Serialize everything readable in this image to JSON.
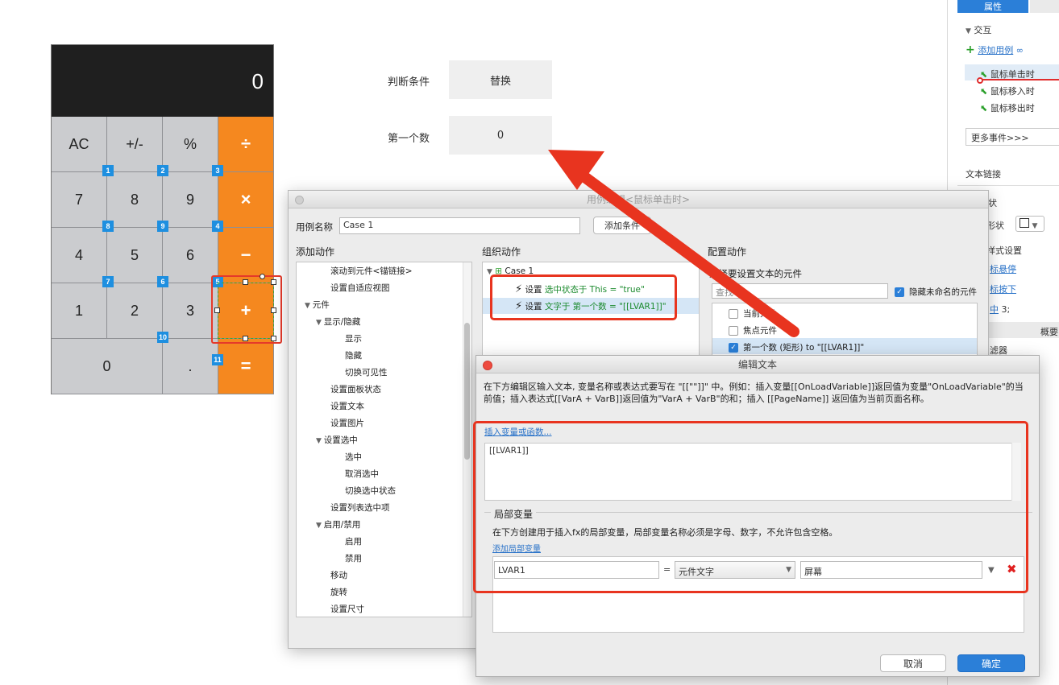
{
  "calculator": {
    "display": "0",
    "keys": [
      {
        "label": "AC",
        "op": false
      },
      {
        "label": "+/-",
        "op": false
      },
      {
        "label": "%",
        "op": false
      },
      {
        "label": "÷",
        "op": true
      },
      {
        "label": "7",
        "op": false
      },
      {
        "label": "8",
        "op": false
      },
      {
        "label": "9",
        "op": false
      },
      {
        "label": "×",
        "op": true
      },
      {
        "label": "4",
        "op": false
      },
      {
        "label": "5",
        "op": false
      },
      {
        "label": "6",
        "op": false
      },
      {
        "label": "−",
        "op": true
      },
      {
        "label": "1",
        "op": false
      },
      {
        "label": "2",
        "op": false
      },
      {
        "label": "3",
        "op": false
      },
      {
        "label": "+",
        "op": true
      },
      {
        "label": "0",
        "op": false
      },
      {
        "label": ".",
        "op": false
      },
      {
        "label": "=",
        "op": true
      }
    ],
    "tags": [
      "1",
      "2",
      "3",
      "8",
      "9",
      "4",
      "7",
      "6",
      "5",
      "10",
      "11"
    ],
    "accent_color": "#f5881f"
  },
  "canvas": {
    "condition_label": "判断条件",
    "condition_value": "替换",
    "first_number_label": "第一个数",
    "first_number_value": "0"
  },
  "right_panel": {
    "tab_properties": "属性",
    "section_interaction": "交互",
    "add_case": "添加用例",
    "events": [
      "鼠标单击时",
      "鼠标移入时",
      "鼠标移出时"
    ],
    "more_events": "更多事件>>>",
    "text_link": "文本链接",
    "shape_label": "形状",
    "style_settings": "样式设置",
    "hover_link": "标悬停",
    "pressed_link": "标按下",
    "selected_text": "中",
    "selected_value": "3;",
    "overview_tab": "概要",
    "filter_label": "滤器"
  },
  "case_dialog": {
    "title": "用例编辑<鼠标单击时>",
    "case_name_label": "用例名称",
    "case_name_value": "Case 1",
    "add_condition": "添加条件",
    "col_add_action": "添加动作",
    "col_organize": "组织动作",
    "col_configure": "配置动作",
    "action_tree": [
      "滚动到元件<锚链接>",
      "设置自适应视图",
      "元件",
      "显示/隐藏",
      "显示",
      "隐藏",
      "切换可见性",
      "设置面板状态",
      "设置文本",
      "设置图片",
      "设置选中",
      "选中",
      "取消选中",
      "切换选中状态",
      "设置列表选中项",
      "启用/禁用",
      "启用",
      "禁用",
      "移动",
      "旋转",
      "设置尺寸"
    ],
    "case_node": "Case 1",
    "action1_prefix": "设置",
    "action1_green": "选中状态于 This = \"true\"",
    "action2_prefix": "设置",
    "action2_green": "文字于 第一个数 = \"[[LVAR1]]\"",
    "config_title": "选择要设置文本的元件",
    "search_placeholder": "查找",
    "hide_unnamed": "隐藏未命名的元件",
    "config_items": [
      "当前元件",
      "焦点元件",
      "第一个数 (矩形) to \"[[LVAR1]]\""
    ]
  },
  "edit_dialog": {
    "title": "编辑文本",
    "description": "在下方编辑区输入文本, 变量名称或表达式要写在 \"[[\"\"]]\" 中。例如：插入变量[[OnLoadVariable]]返回值为变量\"OnLoadVariable\"的当前值；插入表达式[[VarA + VarB]]返回值为\"VarA + VarB\"的和；插入 [[PageName]] 返回值为当前页面名称。",
    "insert_link": "插入变量或函数...",
    "text_content": "[[LVAR1]]",
    "local_var_title": "局部变量",
    "local_var_desc": "在下方创建用于插入fx的局部变量，局部变量名称必须是字母、数字，不允许包含空格。",
    "add_local_var": "添加局部变量",
    "var_name": "LVAR1",
    "equals": "=",
    "var_type": "元件文字",
    "var_target": "屏幕",
    "cancel": "取消",
    "ok": "确定"
  }
}
